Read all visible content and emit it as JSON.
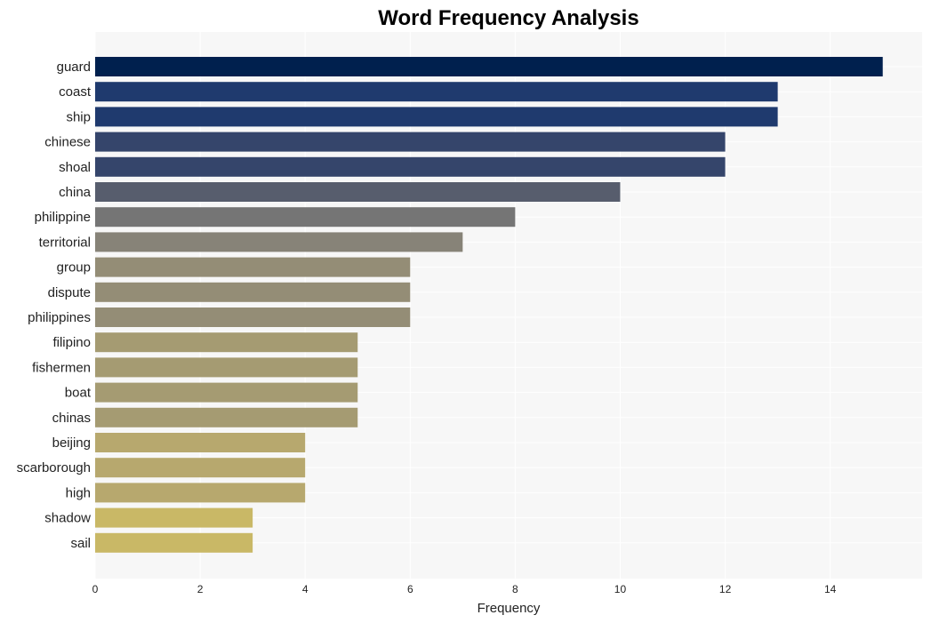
{
  "chart_data": {
    "type": "bar",
    "orientation": "horizontal",
    "title": "Word Frequency Analysis",
    "xlabel": "Frequency",
    "ylabel": "",
    "xlim": [
      0,
      15.75
    ],
    "xticks": [
      0,
      2,
      4,
      6,
      8,
      10,
      12,
      14
    ],
    "grid": true,
    "categories": [
      "guard",
      "coast",
      "ship",
      "chinese",
      "shoal",
      "china",
      "philippine",
      "territorial",
      "group",
      "dispute",
      "philippines",
      "filipino",
      "fishermen",
      "boat",
      "chinas",
      "beijing",
      "scarborough",
      "high",
      "shadow",
      "sail"
    ],
    "values": [
      15,
      13,
      13,
      12,
      12,
      10,
      8,
      7,
      6,
      6,
      6,
      5,
      5,
      5,
      5,
      4,
      4,
      4,
      3,
      3
    ],
    "colors": [
      "#00204e",
      "#1f3a6e",
      "#1f3a6e",
      "#35456b",
      "#35456b",
      "#575d6d",
      "#757575",
      "#878378",
      "#948d76",
      "#948d76",
      "#948d76",
      "#a59b72",
      "#a59b72",
      "#a59b72",
      "#a59b72",
      "#b7a86e",
      "#b7a86e",
      "#b7a86e",
      "#c9b866",
      "#c9b866"
    ]
  }
}
